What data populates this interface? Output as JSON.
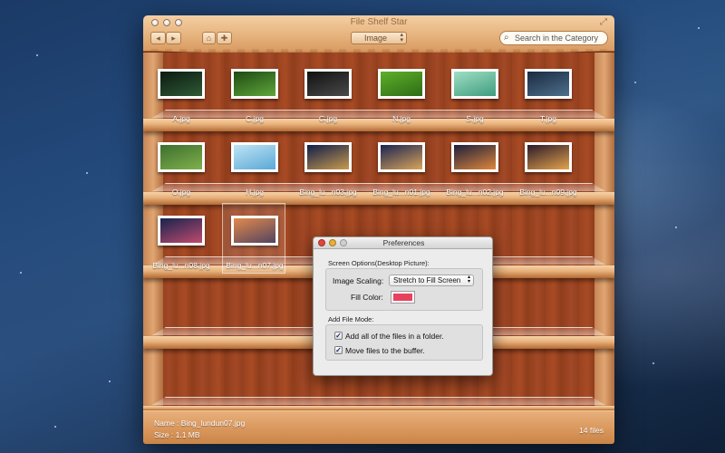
{
  "window": {
    "title": "File Shelf Star",
    "toolbar": {
      "back_label": "◂",
      "forward_label": "▸",
      "home_label": "⌂",
      "add_label": "✚",
      "category_select_value": "Image",
      "search_placeholder": "Search in the Category"
    },
    "shelves": [
      {
        "files": [
          {
            "name": "A.jpg",
            "colors": [
              "#0b1a10",
              "#2f5a36"
            ]
          },
          {
            "name": "C.jpg",
            "colors": [
              "#1d4a14",
              "#5fa63a"
            ]
          },
          {
            "name": "G.jpg",
            "colors": [
              "#111111",
              "#4a4a4a"
            ]
          },
          {
            "name": "N.jpg",
            "colors": [
              "#5fb02a",
              "#2d6b16"
            ]
          },
          {
            "name": "S.jpg",
            "colors": [
              "#9fdfc4",
              "#3f9c7e"
            ]
          },
          {
            "name": "T.jpg",
            "colors": [
              "#1b2a40",
              "#4d6f8c"
            ]
          }
        ]
      },
      {
        "files": [
          {
            "name": "O.jpg",
            "colors": [
              "#3e6e2e",
              "#7fb14c"
            ]
          },
          {
            "name": "H.jpg",
            "colors": [
              "#bfe4f5",
              "#5aa8d6"
            ]
          },
          {
            "name": "Bing_lu...n03.jpg",
            "colors": [
              "#0f1e4a",
              "#c99a4e"
            ]
          },
          {
            "name": "Bing_lu...n01.jpg",
            "colors": [
              "#1a2352",
              "#d9a55a"
            ]
          },
          {
            "name": "Bing_lu...n02.jpg",
            "colors": [
              "#1b1f3e",
              "#e0873a"
            ]
          },
          {
            "name": "Bing_lu...n09.jpg",
            "colors": [
              "#2a1a2a",
              "#e4a34c"
            ]
          }
        ]
      },
      {
        "files": [
          {
            "name": "Bing_lu...n08.jpg",
            "colors": [
              "#16244e",
              "#c04a6e"
            ]
          },
          {
            "name": "Bing_lu...n07.jpg",
            "colors": [
              "#e07a34",
              "#3a2a4a"
            ]
          }
        ]
      }
    ],
    "status": {
      "name_line": "Name :  Bing_lundun07.jpg",
      "size_line": "Size   :  1.1 MB",
      "count": "14 files"
    }
  },
  "preferences": {
    "title": "Preferences",
    "screen_section": "Screen Options(Desktop Picture):",
    "image_scaling_label": "Image Scaling:",
    "image_scaling_value": "Stretch to Fill Screen",
    "fill_color_label": "Fill Color:",
    "fill_color": "#e8415e",
    "add_mode_section": "Add File Mode:",
    "option_add_all": "Add all of the files in a folder.",
    "option_move": "Move files to the buffer.",
    "check_mark": "✓"
  }
}
